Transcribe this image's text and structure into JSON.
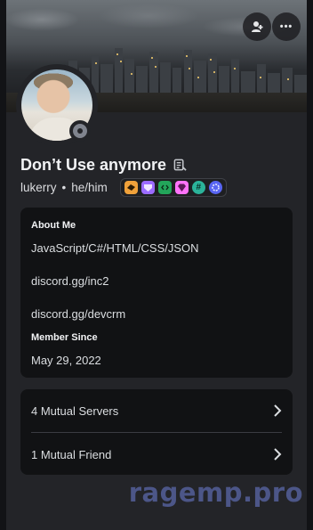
{
  "profile": {
    "display_name": "Don’t Use anymore",
    "username": "lukerry",
    "separator": "•",
    "pronouns": "he/him",
    "status": "offline"
  },
  "header_buttons": {
    "friend_icon": "add-friend-icon",
    "more_label": "•••"
  },
  "badges": [
    {
      "icon": "hypesquad-balance-icon",
      "color": "#f0a13a"
    },
    {
      "icon": "nitro-icon",
      "color": "#9b6bff"
    },
    {
      "icon": "active-developer-icon",
      "color": "#23a55a"
    },
    {
      "icon": "server-booster-gem-icon",
      "color": "#ff73fa"
    },
    {
      "icon": "hashtag-quest-icon",
      "color": "#2bb39a"
    },
    {
      "icon": "gear-badge-icon",
      "color": "#5865f2"
    }
  ],
  "about": {
    "title": "About Me",
    "lines": [
      "JavaScript/C#/HTML/CSS/JSON",
      "discord.gg/inc2",
      "discord.gg/devcrm"
    ],
    "member_since_title": "Member Since",
    "member_since": "May 29, 2022"
  },
  "mutuals": {
    "servers": "4 Mutual Servers",
    "friends": "1 Mutual Friend"
  },
  "watermark": "ragemp.pro"
}
